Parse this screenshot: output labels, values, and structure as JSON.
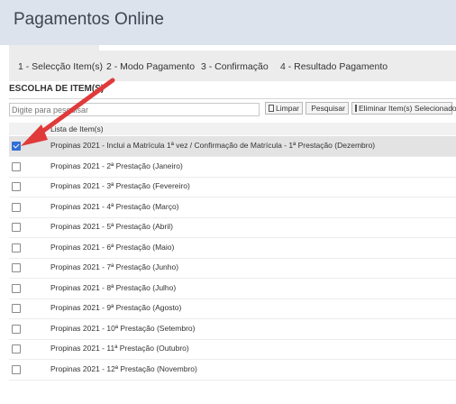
{
  "header": {
    "title": "Pagamentos Online"
  },
  "tabs": [
    {
      "label": "1 - Selecção Item(s)"
    },
    {
      "label": "2 - Modo Pagamento"
    },
    {
      "label": "3 - Confirmação"
    },
    {
      "label": "4 - Resultado Pagamento"
    }
  ],
  "section": {
    "title": "ESCOLHA DE ITEM(S)"
  },
  "search": {
    "placeholder": "Digite para pesquisar"
  },
  "buttons": {
    "clear": "Limpar",
    "search": "Pesquisar",
    "remove": "Eliminar Item(s) Selecionados"
  },
  "list": {
    "header": "Lista de Item(s)",
    "items": [
      {
        "label": "Propinas 2021 - Inclui a Matrícula 1ª vez / Confirmação de Matrícula - 1ª Prestação (Dezembro)",
        "checked": true
      },
      {
        "label": "Propinas 2021 - 2ª Prestação (Janeiro)",
        "checked": false
      },
      {
        "label": "Propinas 2021 - 3ª Prestação (Fevereiro)",
        "checked": false
      },
      {
        "label": "Propinas 2021 - 4ª Prestação (Março)",
        "checked": false
      },
      {
        "label": "Propinas 2021 - 5ª Prestação (Abril)",
        "checked": false
      },
      {
        "label": "Propinas 2021 - 6ª Prestação (Maio)",
        "checked": false
      },
      {
        "label": "Propinas 2021 - 7ª Prestação (Junho)",
        "checked": false
      },
      {
        "label": "Propinas 2021 - 8ª Prestação (Julho)",
        "checked": false
      },
      {
        "label": "Propinas 2021 - 9ª Prestação (Agosto)",
        "checked": false
      },
      {
        "label": "Propinas 2021 - 10ª Prestação (Setembro)",
        "checked": false
      },
      {
        "label": "Propinas 2021 - 11ª Prestação (Outubro)",
        "checked": false
      },
      {
        "label": "Propinas 2021 - 12ª Prestação (Novembro)",
        "checked": false
      }
    ]
  },
  "colors": {
    "checkbox_checked": "#2f6fd6",
    "annotation_arrow": "#e03a3a",
    "header_bg": "#dde3ec"
  }
}
